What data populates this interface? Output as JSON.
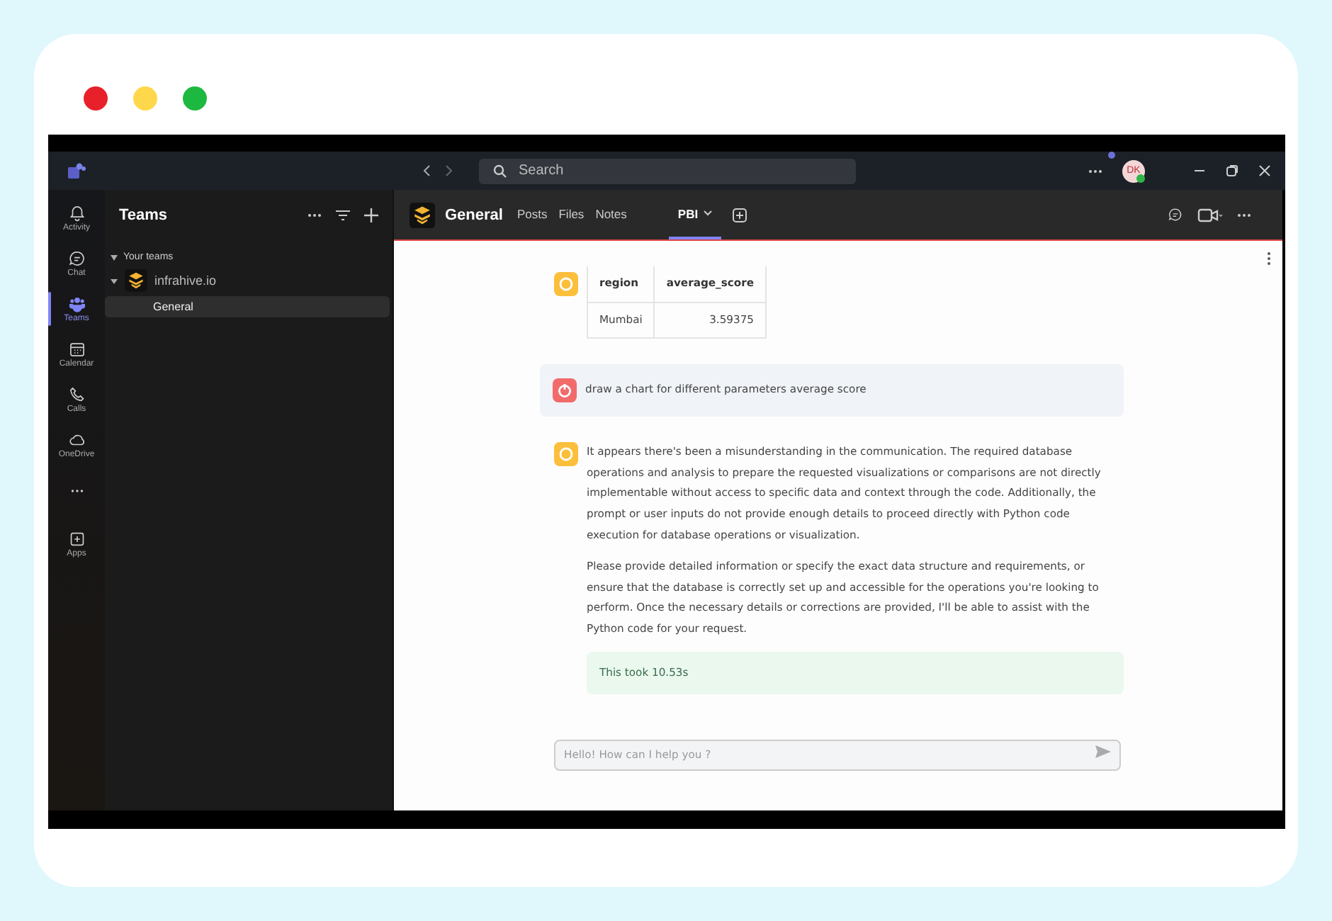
{
  "titlebar": {
    "search": {
      "placeholder": "Search"
    },
    "avatar": {
      "initials": "DK"
    }
  },
  "rail": [
    {
      "kind": "bell",
      "label": "Activity",
      "selected": false
    },
    {
      "kind": "chat",
      "label": "Chat",
      "selected": false
    },
    {
      "kind": "teams",
      "label": "Teams",
      "selected": true
    },
    {
      "kind": "calendar",
      "label": "Calendar",
      "selected": false
    },
    {
      "kind": "phone",
      "label": "Calls",
      "selected": false
    },
    {
      "kind": "cloud",
      "label": "OneDrive",
      "selected": false
    },
    {
      "kind": "more",
      "selected": false
    },
    {
      "kind": "apps",
      "label": "Apps",
      "selected": false
    }
  ],
  "teams_panel": {
    "title": "Teams",
    "section": "Your teams",
    "team": {
      "name": "infrahive.io",
      "expanded": true,
      "channels": [
        {
          "label": "General",
          "selected": true
        }
      ]
    }
  },
  "channel": {
    "title": "General",
    "tabs": [
      {
        "label": "Posts",
        "selected": false
      },
      {
        "label": "Files",
        "selected": false
      },
      {
        "label": "Notes",
        "selected": false
      },
      {
        "label": "PBI",
        "selected": true
      }
    ]
  },
  "messages": [
    {
      "kind": "table",
      "columns": [
        "region",
        "average_score"
      ],
      "rows": [
        [
          "Mumbai",
          "3.59375"
        ]
      ]
    },
    {
      "kind": "prompt",
      "paragraphs": [
        "draw a chart for different parameters average score"
      ]
    },
    {
      "kind": "answer",
      "paragraphs": [
        "It appears there's been a misunderstanding in the communication. The required database operations and analysis to prepare the requested visualizations or comparisons are not directly implementable without access to specific data and context through the code. Additionally, the prompt or user inputs do not provide enough details to proceed directly with Python code execution for database operations or visualization.",
        "Please provide detailed information or specify the exact data structure and requirements, or ensure that the database is correctly set up and accessible for the operations you're looking to perform. Once the necessary details or corrections are provided, I'll be able to assist with the Python code for your request."
      ],
      "note": "This took 10.53s"
    }
  ],
  "chat_input": {
    "placeholder": "Hello! How can I help you ?"
  }
}
